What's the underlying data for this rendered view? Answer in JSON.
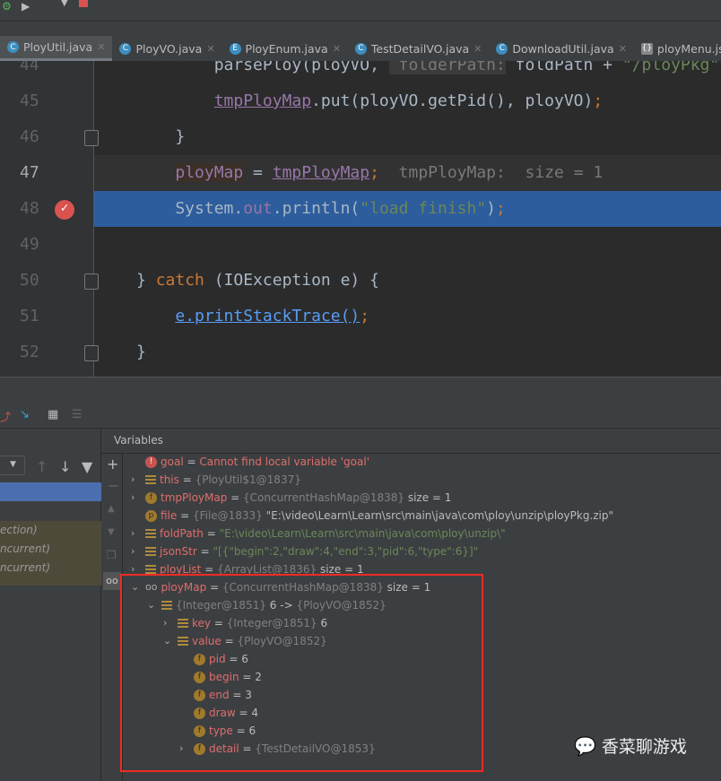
{
  "tabs": [
    {
      "label": "PloyUtil.java",
      "icon": "class-icon",
      "active": true
    },
    {
      "label": "PloyVO.java",
      "icon": "class-icon"
    },
    {
      "label": "PloyEnum.java",
      "icon": "enum-icon"
    },
    {
      "label": "TestDetailVO.java",
      "icon": "class-icon"
    },
    {
      "label": "DownloadUtil.java",
      "icon": "class-icon"
    },
    {
      "label": "ployMenu.json",
      "icon": "json-file-icon"
    }
  ],
  "editor": {
    "lines": [
      {
        "n": "44",
        "html": "        parsePloy(ployVO, <span class='hint' style='background:#3b3b3b'> folderPath:</span> foldPath + <span class='str'>\"/ployPkg\"</span>)"
      },
      {
        "n": "45",
        "html": "        <span class='fld ul'>tmpPloyMap</span>.put(ployVO.getPid(), ployVO)<span class='kw'>;</span>"
      },
      {
        "n": "46",
        "html": "    }"
      },
      {
        "n": "47",
        "html": "    <span class='fld' style='background:#3b3028'>ployMap</span> = <span class='fld ul'>tmpPloyMap</span><span class='kw'>;</span>  <span class='hint'>tmpPloyMap:  size = 1</span>"
      },
      {
        "n": "48",
        "html": "    System.<span class='fld'>out</span>.println(<span class='str'>\"load finish\"</span>)<span class='kw'>;</span>"
      },
      {
        "n": "49",
        "html": ""
      },
      {
        "n": "50",
        "html": "} <span class='kw'>catch</span> (IOException e) {"
      },
      {
        "n": "51",
        "html": "    <span class='ul' style='color:#589df6'>e.printStackTrace()</span><span class='kw'>;</span>"
      },
      {
        "n": "52",
        "html": "}"
      }
    ]
  },
  "frames": {
    "items": [
      "ection)",
      "ncurrent)",
      "ncurrent)"
    ]
  },
  "variables": {
    "title": "Variables",
    "rows": [
      {
        "d": 0,
        "arrow": "",
        "icon": "error",
        "name": "goal",
        "eq": " = ",
        "type": "",
        "val": "Cannot find local variable 'goal'",
        "vc": "nm"
      },
      {
        "d": 0,
        "arrow": ">",
        "icon": "bars",
        "name": "this",
        "eq": " = ",
        "type": "{PloyUtil$1@1837}",
        "val": ""
      },
      {
        "d": 0,
        "arrow": ">",
        "icon": "f",
        "name": "tmpPloyMap",
        "eq": " = ",
        "type": "{ConcurrentHashMap@1838}",
        "val": " size = 1",
        "vc": "pl"
      },
      {
        "d": 0,
        "arrow": "",
        "icon": "p",
        "name": "file",
        "eq": " = ",
        "type": "{File@1833}",
        "val": " \"E:\\video\\Learn\\Learn\\src\\main\\java\\com\\ploy\\unzip\\ployPkg.zip\"",
        "vc": "pl"
      },
      {
        "d": 0,
        "arrow": ">",
        "icon": "bars",
        "name": "foldPath",
        "eq": " = ",
        "type": "",
        "val": "\"E:\\video\\Learn\\Learn\\src\\main\\java\\com\\ploy\\unzip\\\"",
        "vc": "sv"
      },
      {
        "d": 0,
        "arrow": ">",
        "icon": "bars",
        "name": "jsonStr",
        "eq": " = ",
        "type": "",
        "val": "\"[{\"begin\":2,\"draw\":4,\"end\":3,\"pid\":6,\"type\":6}]\"",
        "vc": "sv"
      },
      {
        "d": 0,
        "arrow": ">",
        "icon": "bars",
        "name": "ployList",
        "eq": " = ",
        "type": "{ArrayList@1836}",
        "val": "  size = 1",
        "vc": "pl"
      },
      {
        "d": 0,
        "arrow": "v",
        "icon": "watch",
        "name": "ployMap",
        "eq": " = ",
        "type": "{ConcurrentHashMap@1838}",
        "val": "  size = 1",
        "vc": "pl"
      },
      {
        "d": 1,
        "arrow": "v",
        "icon": "bars",
        "name": "",
        "eq": "",
        "type": "{Integer@1851}",
        "val": " 6 -> ",
        "vc": "pl",
        "type2": "{PloyVO@1852}"
      },
      {
        "d": 2,
        "arrow": ">",
        "icon": "bars",
        "name": "key",
        "eq": " = ",
        "type": "{Integer@1851}",
        "val": " 6",
        "vc": "pl"
      },
      {
        "d": 2,
        "arrow": "v",
        "icon": "bars",
        "name": "value",
        "eq": " = ",
        "type": "{PloyVO@1852}",
        "val": ""
      },
      {
        "d": 3,
        "arrow": "",
        "icon": "f",
        "name": "pid",
        "eq": " = ",
        "type": "",
        "val": "6",
        "vc": "pl"
      },
      {
        "d": 3,
        "arrow": "",
        "icon": "f",
        "name": "begin",
        "eq": " = ",
        "type": "",
        "val": "2",
        "vc": "pl"
      },
      {
        "d": 3,
        "arrow": "",
        "icon": "f",
        "name": "end",
        "eq": " = ",
        "type": "",
        "val": "3",
        "vc": "pl"
      },
      {
        "d": 3,
        "arrow": "",
        "icon": "f",
        "name": "draw",
        "eq": " = ",
        "type": "",
        "val": "4",
        "vc": "pl"
      },
      {
        "d": 3,
        "arrow": "",
        "icon": "f",
        "name": "type",
        "eq": " = ",
        "type": "",
        "val": "6",
        "vc": "pl"
      },
      {
        "d": 3,
        "arrow": ">",
        "icon": "f",
        "name": "detail",
        "eq": " = ",
        "type": "{TestDetailVO@1853}",
        "val": ""
      }
    ]
  },
  "watermark": {
    "text": "香菜聊游戏",
    "icon": "wechat-icon"
  },
  "colors": {
    "highlight": "#2d5d9c",
    "breakpoint": "#d9534f",
    "annotation": "#ee2b24"
  }
}
